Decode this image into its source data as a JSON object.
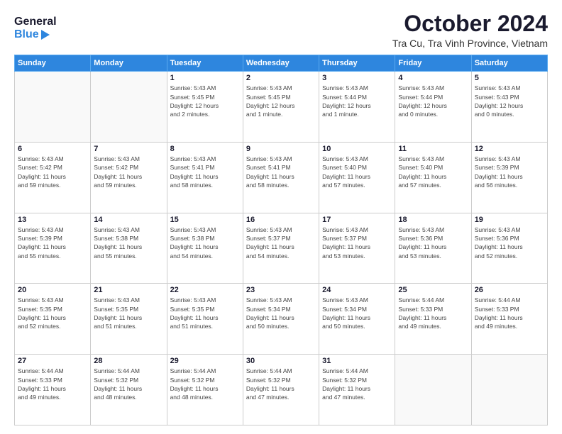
{
  "header": {
    "logo_line1": "General",
    "logo_line2": "Blue",
    "month": "October 2024",
    "location": "Tra Cu, Tra Vinh Province, Vietnam"
  },
  "days_of_week": [
    "Sunday",
    "Monday",
    "Tuesday",
    "Wednesday",
    "Thursday",
    "Friday",
    "Saturday"
  ],
  "weeks": [
    [
      {
        "day": "",
        "info": ""
      },
      {
        "day": "",
        "info": ""
      },
      {
        "day": "1",
        "info": "Sunrise: 5:43 AM\nSunset: 5:45 PM\nDaylight: 12 hours\nand 2 minutes."
      },
      {
        "day": "2",
        "info": "Sunrise: 5:43 AM\nSunset: 5:45 PM\nDaylight: 12 hours\nand 1 minute."
      },
      {
        "day": "3",
        "info": "Sunrise: 5:43 AM\nSunset: 5:44 PM\nDaylight: 12 hours\nand 1 minute."
      },
      {
        "day": "4",
        "info": "Sunrise: 5:43 AM\nSunset: 5:44 PM\nDaylight: 12 hours\nand 0 minutes."
      },
      {
        "day": "5",
        "info": "Sunrise: 5:43 AM\nSunset: 5:43 PM\nDaylight: 12 hours\nand 0 minutes."
      }
    ],
    [
      {
        "day": "6",
        "info": "Sunrise: 5:43 AM\nSunset: 5:42 PM\nDaylight: 11 hours\nand 59 minutes."
      },
      {
        "day": "7",
        "info": "Sunrise: 5:43 AM\nSunset: 5:42 PM\nDaylight: 11 hours\nand 59 minutes."
      },
      {
        "day": "8",
        "info": "Sunrise: 5:43 AM\nSunset: 5:41 PM\nDaylight: 11 hours\nand 58 minutes."
      },
      {
        "day": "9",
        "info": "Sunrise: 5:43 AM\nSunset: 5:41 PM\nDaylight: 11 hours\nand 58 minutes."
      },
      {
        "day": "10",
        "info": "Sunrise: 5:43 AM\nSunset: 5:40 PM\nDaylight: 11 hours\nand 57 minutes."
      },
      {
        "day": "11",
        "info": "Sunrise: 5:43 AM\nSunset: 5:40 PM\nDaylight: 11 hours\nand 57 minutes."
      },
      {
        "day": "12",
        "info": "Sunrise: 5:43 AM\nSunset: 5:39 PM\nDaylight: 11 hours\nand 56 minutes."
      }
    ],
    [
      {
        "day": "13",
        "info": "Sunrise: 5:43 AM\nSunset: 5:39 PM\nDaylight: 11 hours\nand 55 minutes."
      },
      {
        "day": "14",
        "info": "Sunrise: 5:43 AM\nSunset: 5:38 PM\nDaylight: 11 hours\nand 55 minutes."
      },
      {
        "day": "15",
        "info": "Sunrise: 5:43 AM\nSunset: 5:38 PM\nDaylight: 11 hours\nand 54 minutes."
      },
      {
        "day": "16",
        "info": "Sunrise: 5:43 AM\nSunset: 5:37 PM\nDaylight: 11 hours\nand 54 minutes."
      },
      {
        "day": "17",
        "info": "Sunrise: 5:43 AM\nSunset: 5:37 PM\nDaylight: 11 hours\nand 53 minutes."
      },
      {
        "day": "18",
        "info": "Sunrise: 5:43 AM\nSunset: 5:36 PM\nDaylight: 11 hours\nand 53 minutes."
      },
      {
        "day": "19",
        "info": "Sunrise: 5:43 AM\nSunset: 5:36 PM\nDaylight: 11 hours\nand 52 minutes."
      }
    ],
    [
      {
        "day": "20",
        "info": "Sunrise: 5:43 AM\nSunset: 5:35 PM\nDaylight: 11 hours\nand 52 minutes."
      },
      {
        "day": "21",
        "info": "Sunrise: 5:43 AM\nSunset: 5:35 PM\nDaylight: 11 hours\nand 51 minutes."
      },
      {
        "day": "22",
        "info": "Sunrise: 5:43 AM\nSunset: 5:35 PM\nDaylight: 11 hours\nand 51 minutes."
      },
      {
        "day": "23",
        "info": "Sunrise: 5:43 AM\nSunset: 5:34 PM\nDaylight: 11 hours\nand 50 minutes."
      },
      {
        "day": "24",
        "info": "Sunrise: 5:43 AM\nSunset: 5:34 PM\nDaylight: 11 hours\nand 50 minutes."
      },
      {
        "day": "25",
        "info": "Sunrise: 5:44 AM\nSunset: 5:33 PM\nDaylight: 11 hours\nand 49 minutes."
      },
      {
        "day": "26",
        "info": "Sunrise: 5:44 AM\nSunset: 5:33 PM\nDaylight: 11 hours\nand 49 minutes."
      }
    ],
    [
      {
        "day": "27",
        "info": "Sunrise: 5:44 AM\nSunset: 5:33 PM\nDaylight: 11 hours\nand 49 minutes."
      },
      {
        "day": "28",
        "info": "Sunrise: 5:44 AM\nSunset: 5:32 PM\nDaylight: 11 hours\nand 48 minutes."
      },
      {
        "day": "29",
        "info": "Sunrise: 5:44 AM\nSunset: 5:32 PM\nDaylight: 11 hours\nand 48 minutes."
      },
      {
        "day": "30",
        "info": "Sunrise: 5:44 AM\nSunset: 5:32 PM\nDaylight: 11 hours\nand 47 minutes."
      },
      {
        "day": "31",
        "info": "Sunrise: 5:44 AM\nSunset: 5:32 PM\nDaylight: 11 hours\nand 47 minutes."
      },
      {
        "day": "",
        "info": ""
      },
      {
        "day": "",
        "info": ""
      }
    ]
  ]
}
